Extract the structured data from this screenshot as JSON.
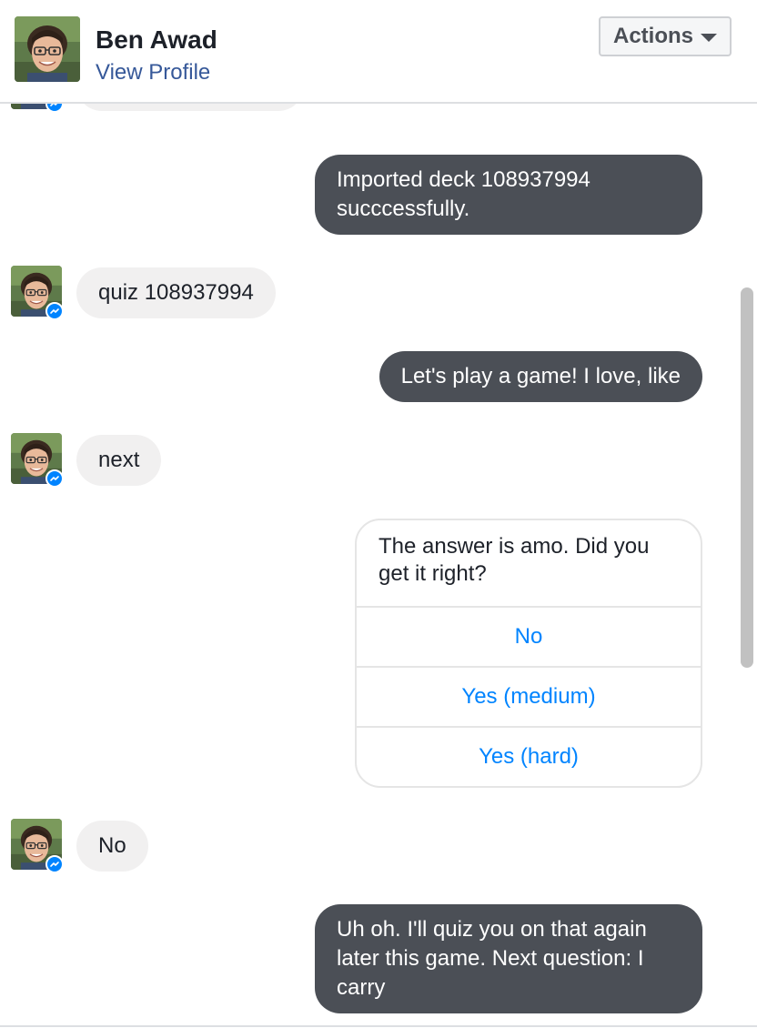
{
  "header": {
    "name": "Ben Awad",
    "profile_link": "View Profile",
    "actions_label": "Actions"
  },
  "icons": {
    "avatar": "profile-photo",
    "badge": "messenger-icon",
    "actions_caret": "caret-down-icon"
  },
  "colors": {
    "outgoing_bubble": "#4b4f56",
    "incoming_bubble": "#f1f0f0",
    "link": "#365899",
    "quick_reply": "#0084ff",
    "messenger_badge": "#0084ff"
  },
  "messages": [
    {
      "from": "user",
      "text": ""
    },
    {
      "from": "bot",
      "text": "Imported deck 108937994 succcessfully."
    },
    {
      "from": "user",
      "text": "quiz 108937994"
    },
    {
      "from": "bot",
      "text": "Let's play a game! I love, like"
    },
    {
      "from": "user",
      "text": "next"
    },
    {
      "from": "bot",
      "card": {
        "text": "The answer is amo. Did you get it right?",
        "buttons": [
          "No",
          "Yes (medium)",
          "Yes (hard)"
        ]
      }
    },
    {
      "from": "user",
      "text": "No"
    },
    {
      "from": "bot",
      "text": "Uh oh. I'll quiz you on that again later this game. Next question: I carry"
    }
  ]
}
